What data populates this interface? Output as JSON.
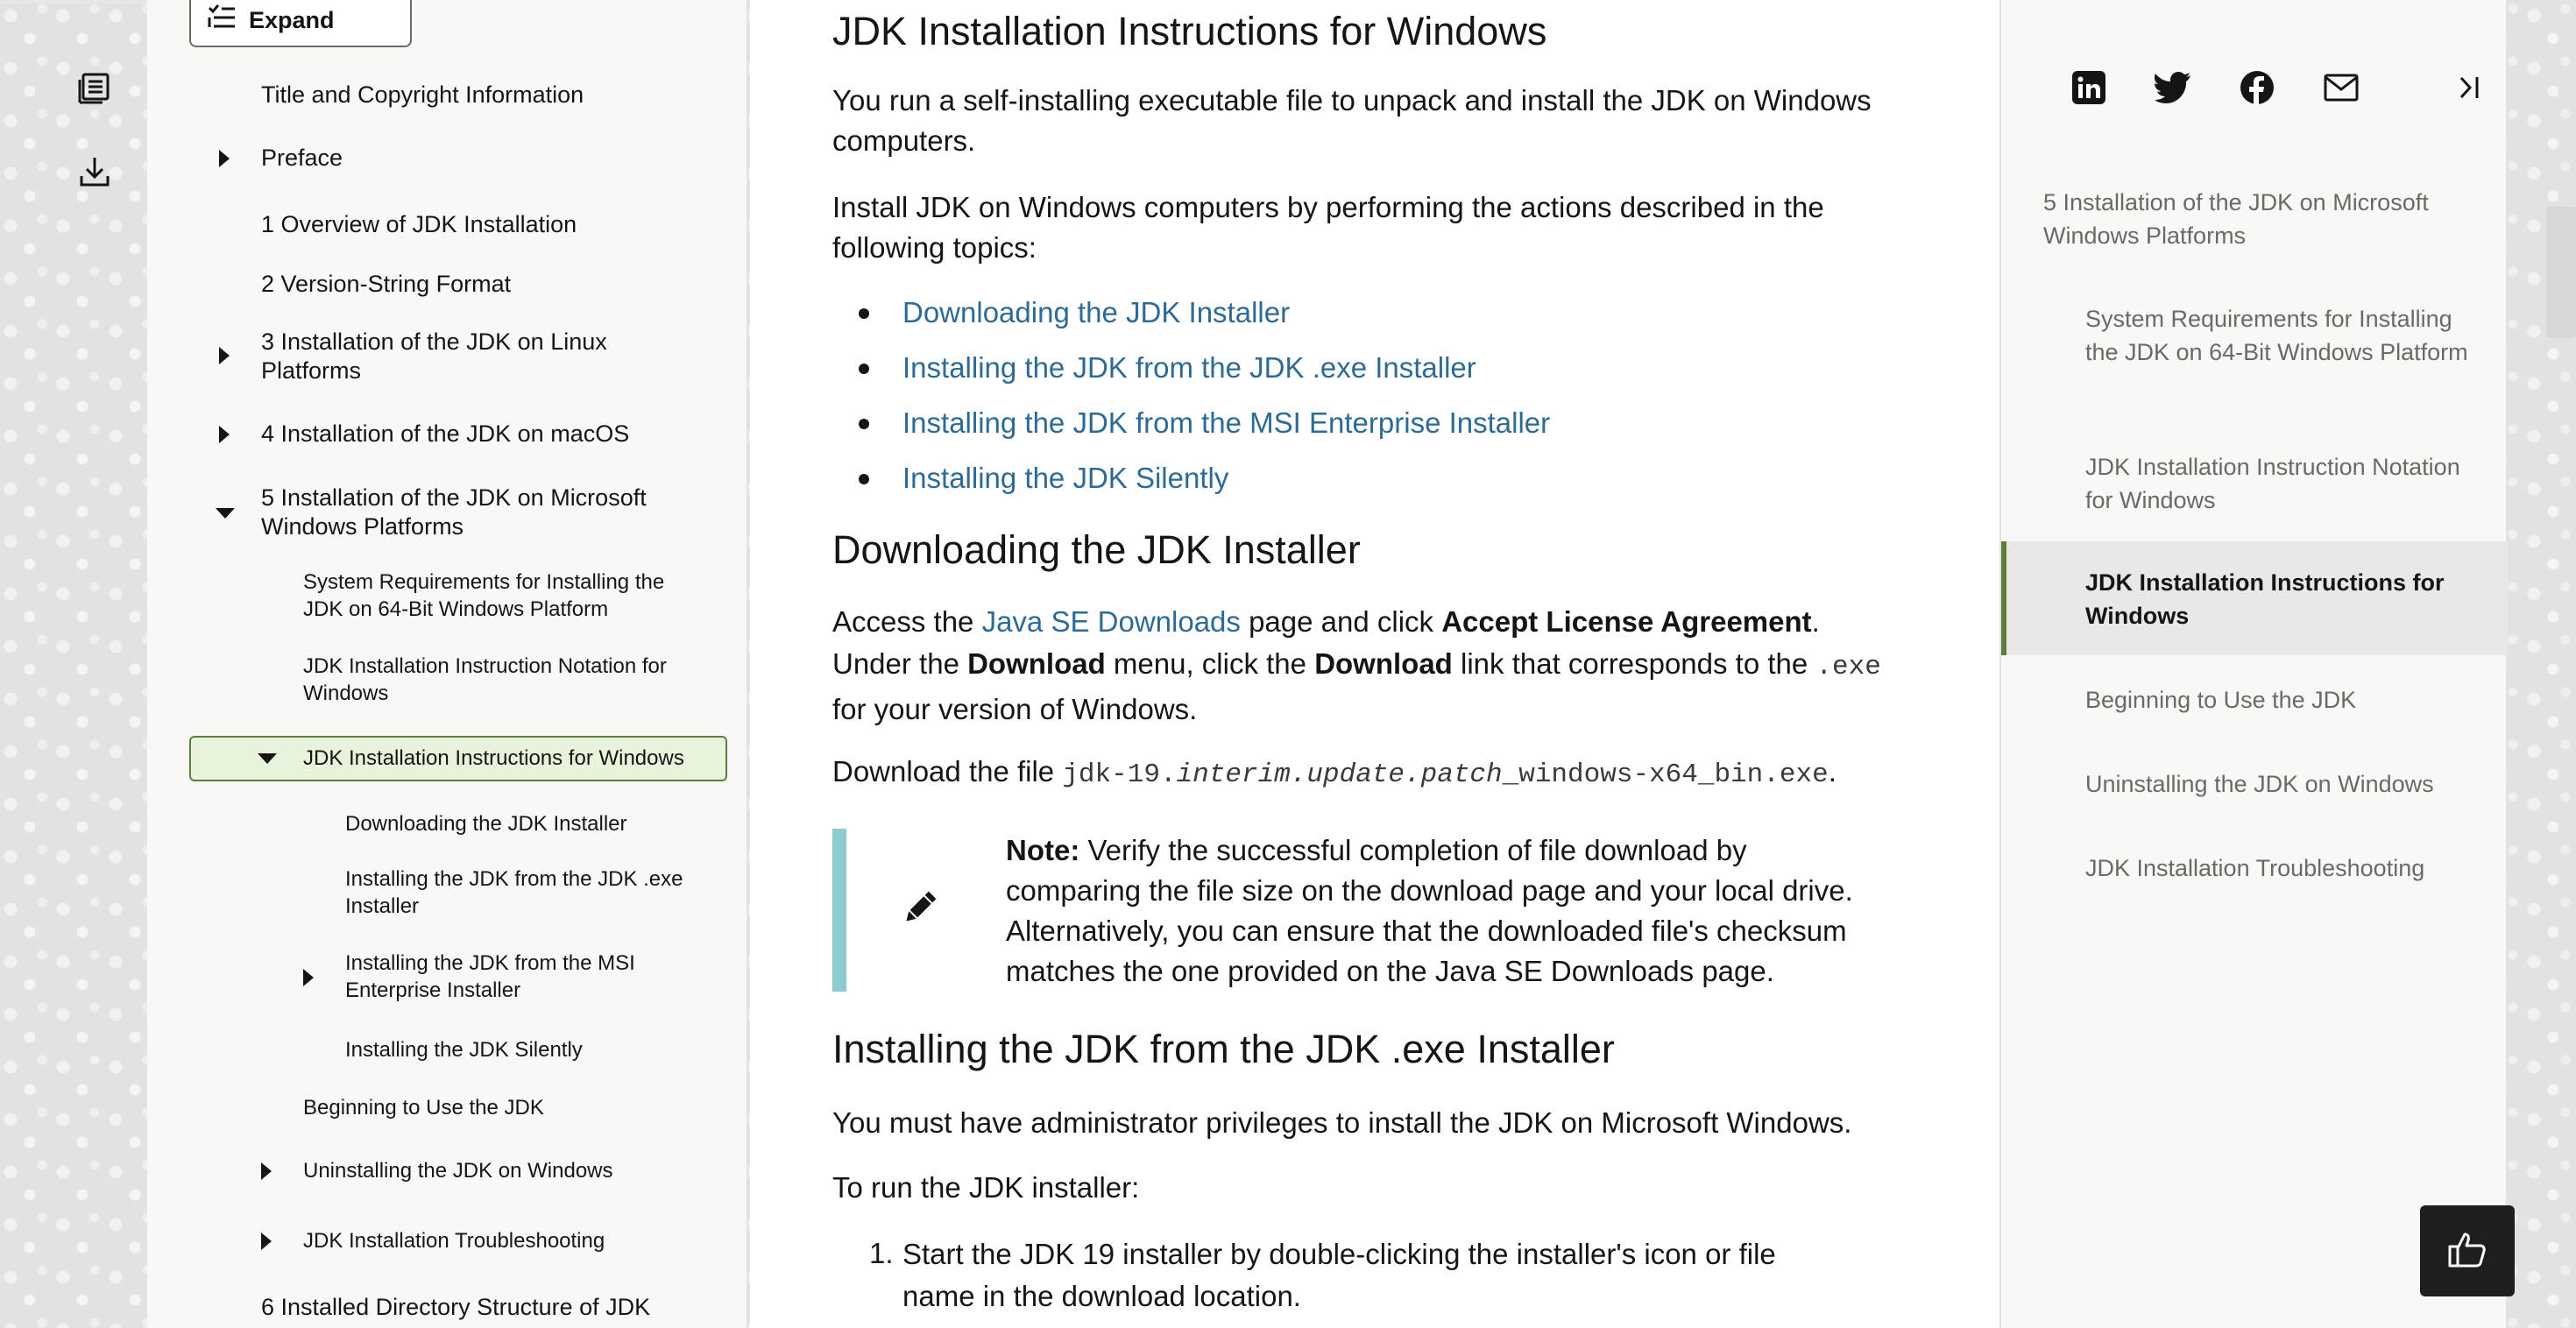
{
  "toc": {
    "expand_label": "Expand",
    "items": [
      {
        "label": "Title and Copyright Information"
      },
      {
        "label": "Preface"
      },
      {
        "label": "1 Overview of JDK Installation"
      },
      {
        "label": "2 Version-String Format"
      },
      {
        "label": "3 Installation of the JDK on Linux Platforms"
      },
      {
        "label": "4 Installation of the JDK on macOS"
      },
      {
        "label": "5 Installation of the JDK on Microsoft Windows Platforms"
      },
      {
        "label": "System Requirements for Installing the JDK on 64-Bit Windows Platform"
      },
      {
        "label": "JDK Installation Instruction Notation for Windows"
      },
      {
        "label": "JDK Installation Instructions for Windows"
      },
      {
        "label": "Downloading the JDK Installer"
      },
      {
        "label": "Installing the JDK from the JDK .exe Installer"
      },
      {
        "label": "Installing the JDK from the MSI Enterprise Installer"
      },
      {
        "label": "Installing the JDK Silently"
      },
      {
        "label": "Beginning to Use the JDK"
      },
      {
        "label": "Uninstalling the JDK on Windows"
      },
      {
        "label": "JDK Installation Troubleshooting"
      },
      {
        "label": "6 Installed Directory Structure of JDK"
      }
    ]
  },
  "main": {
    "title": "JDK Installation Instructions for Windows",
    "intro1": "You run a self-installing executable file to unpack and install the JDK on Windows computers.",
    "intro2": "Install JDK on Windows computers by performing the actions described in the following topics:",
    "topics": [
      "Downloading the JDK Installer",
      "Installing the JDK from the JDK .exe Installer",
      "Installing the JDK from the MSI Enterprise Installer",
      "Installing the JDK Silently"
    ],
    "section1_title": "Downloading the JDK Installer",
    "access": {
      "t1": "Access the ",
      "link": "Java SE Downloads",
      "t2": " page and click ",
      "b1": "Accept License Agreement",
      "t3": ". Under the ",
      "b2": "Download",
      "t4": " menu, click the ",
      "b3": "Download",
      "t5": " link that corresponds to the ",
      "code": ".exe",
      "t6": " for your version of Windows."
    },
    "download_file": {
      "prefix": "Download the file ",
      "code_a": "jdk-19.",
      "code_i": "interim.update.patch",
      "code_b": "_windows-x64_bin.exe",
      "suffix": "."
    },
    "note": {
      "label": "Note:",
      "text": " Verify the successful completion of file download by comparing the file size on the download page and your local drive. Alternatively, you can ensure that the downloaded file's checksum matches the one provided on the Java SE Downloads page.",
      "icon": "pencil-icon"
    },
    "section2_title": "Installing the JDK from the JDK .exe Installer",
    "admin_text": "You must have administrator privileges to install the JDK on Microsoft Windows.",
    "run_text": "To run the JDK installer:",
    "step1_num": "1.",
    "step1": "Start the JDK 19 installer by double-clicking the installer's icon or file name in the download location."
  },
  "right_panel": {
    "share_icons": [
      "linkedin-icon",
      "twitter-icon",
      "facebook-icon",
      "email-icon"
    ],
    "items": [
      "5 Installation of the JDK on Microsoft Windows Platforms",
      "System Requirements for Installing the JDK on 64-Bit Windows Platform",
      "JDK Installation Instruction Notation for Windows",
      "JDK Installation Instructions for Windows",
      "Beginning to Use the JDK",
      "Uninstalling the JDK on Windows",
      "JDK Installation Troubleshooting"
    ]
  },
  "colors": {
    "link": "#2d6a96",
    "active_green": "#5c7d3e",
    "active_bg": "#e8f3dc",
    "note_bar": "#8ecbd1"
  }
}
